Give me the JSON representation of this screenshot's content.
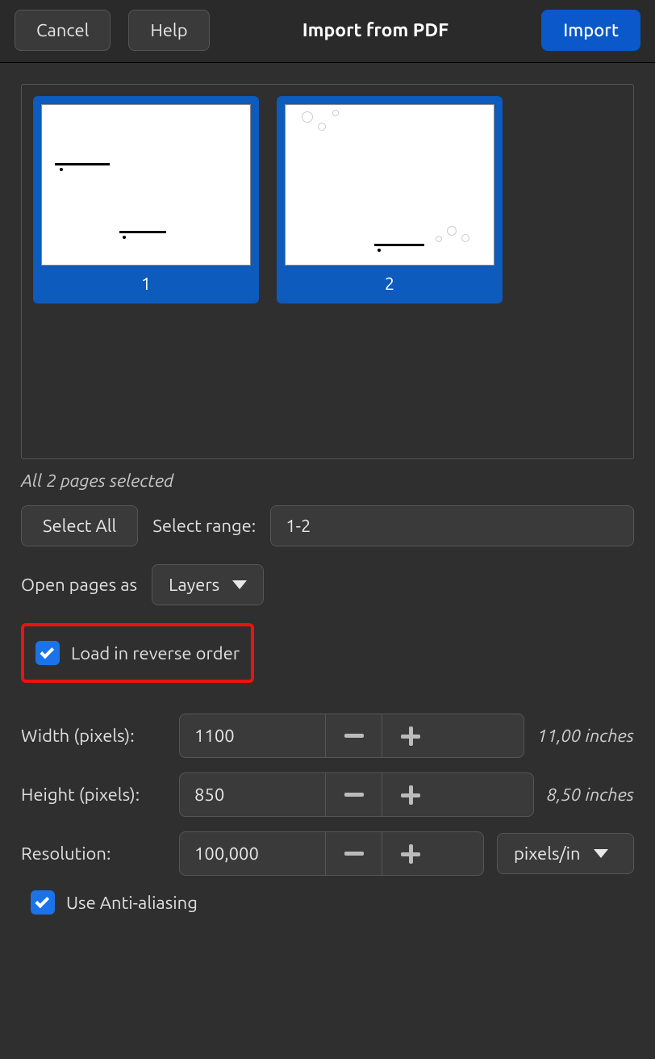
{
  "titlebar": {
    "cancel": "Cancel",
    "help": "Help",
    "title": "Import from PDF",
    "import": "Import"
  },
  "thumbnails": [
    {
      "page": "1"
    },
    {
      "page": "2"
    }
  ],
  "status": "All 2 pages selected",
  "select_all": "Select All",
  "range_label": "Select range:",
  "range_value": "1-2",
  "open_as_label": "Open pages as",
  "open_as_value": "Layers",
  "reverse_label": "Load in reverse order",
  "width_label": "Width (pixels):",
  "width_value": "1100",
  "width_inches": "11,00 inches",
  "height_label": "Height (pixels):",
  "height_value": "850",
  "height_inches": "8,50 inches",
  "res_label": "Resolution:",
  "res_value": "100,000",
  "res_unit": "pixels/in",
  "aa_label": "Use Anti-aliasing"
}
